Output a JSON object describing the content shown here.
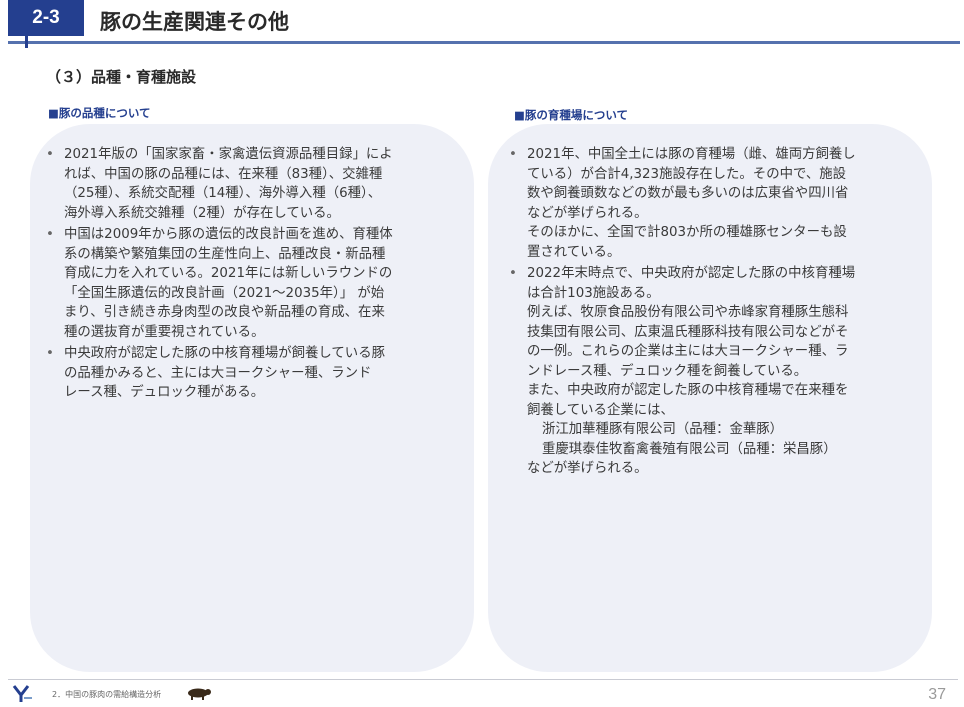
{
  "header": {
    "badge": "2-3",
    "title": "豚の生産関連その他"
  },
  "section_heading": "（３）品種・育種施設",
  "left": {
    "heading": "■豚の品種について",
    "bullets": [
      [
        "2021年版の「国家家畜・家禽遺伝資源品種目録」によ",
        "れば、中国の豚の品種には、在来種（83種）、交雑種",
        "（25種）、系統交配種（14種）、海外導入種（6種）、",
        "海外導入系統交雑種（2種）が存在している。"
      ],
      [
        "中国は2009年から豚の遺伝的改良計画を進め、育種体",
        "系の構築や繁殖集団の生産性向上、品種改良・新品種",
        "育成に力を入れている。2021年には新しいラウンドの",
        "「全国生豚遺伝的改良計画（2021～2035年）」 が始",
        "まり、引き続き赤身肉型の改良や新品種の育成、在来",
        "種の選抜育が重要視されている。"
      ],
      [
        "中央政府が認定した豚の中核育種場が飼養している豚",
        "の品種かみると、主には大ヨークシャー種、ランド",
        "レース種、デュロック種がある。"
      ]
    ]
  },
  "right": {
    "heading": "■豚の育種場について",
    "bullet1": [
      "2021年、中国全土には豚の育種場（雌、雄両方飼養し",
      "ている）が合計4,323施設存在した。その中で、施設",
      "数や飼養頭数などの数が最も多いのは広東省や四川省",
      "などが挙げられる。",
      "そのほかに、全国で計803か所の種雄豚センターも設",
      "置されている。"
    ],
    "bullet2": [
      "2022年末時点で、中央政府が認定した豚の中核育種場",
      "は合計103施設ある。",
      "例えば、牧原食品股份有限公司や赤峰家育種豚生態科",
      "技集団有限公司、広東温氏種豚科技有限公司などがそ",
      "の一例。これらの企業は主には大ヨークシャー種、ラ",
      "ンドレース種、デュロック種を飼養している。",
      "また、中央政府が認定した豚の中核育種場で在来種を",
      "飼養している企業には、"
    ],
    "companies": [
      "浙江加華種豚有限公司（品種：金華豚）",
      "重慶琪泰佳牧畜禽養殖有限公司（品種：栄昌豚）"
    ],
    "closing": "などが挙げられる。"
  },
  "footer": {
    "text": "2．中国の豚肉の需給構造分析",
    "page": "37",
    "logo_icon": "alic-logo-icon",
    "pig_icon": "pig-icon"
  },
  "colors": {
    "accent": "#243f8f",
    "rule": "#5571ae",
    "panel": "#eef0f7"
  }
}
